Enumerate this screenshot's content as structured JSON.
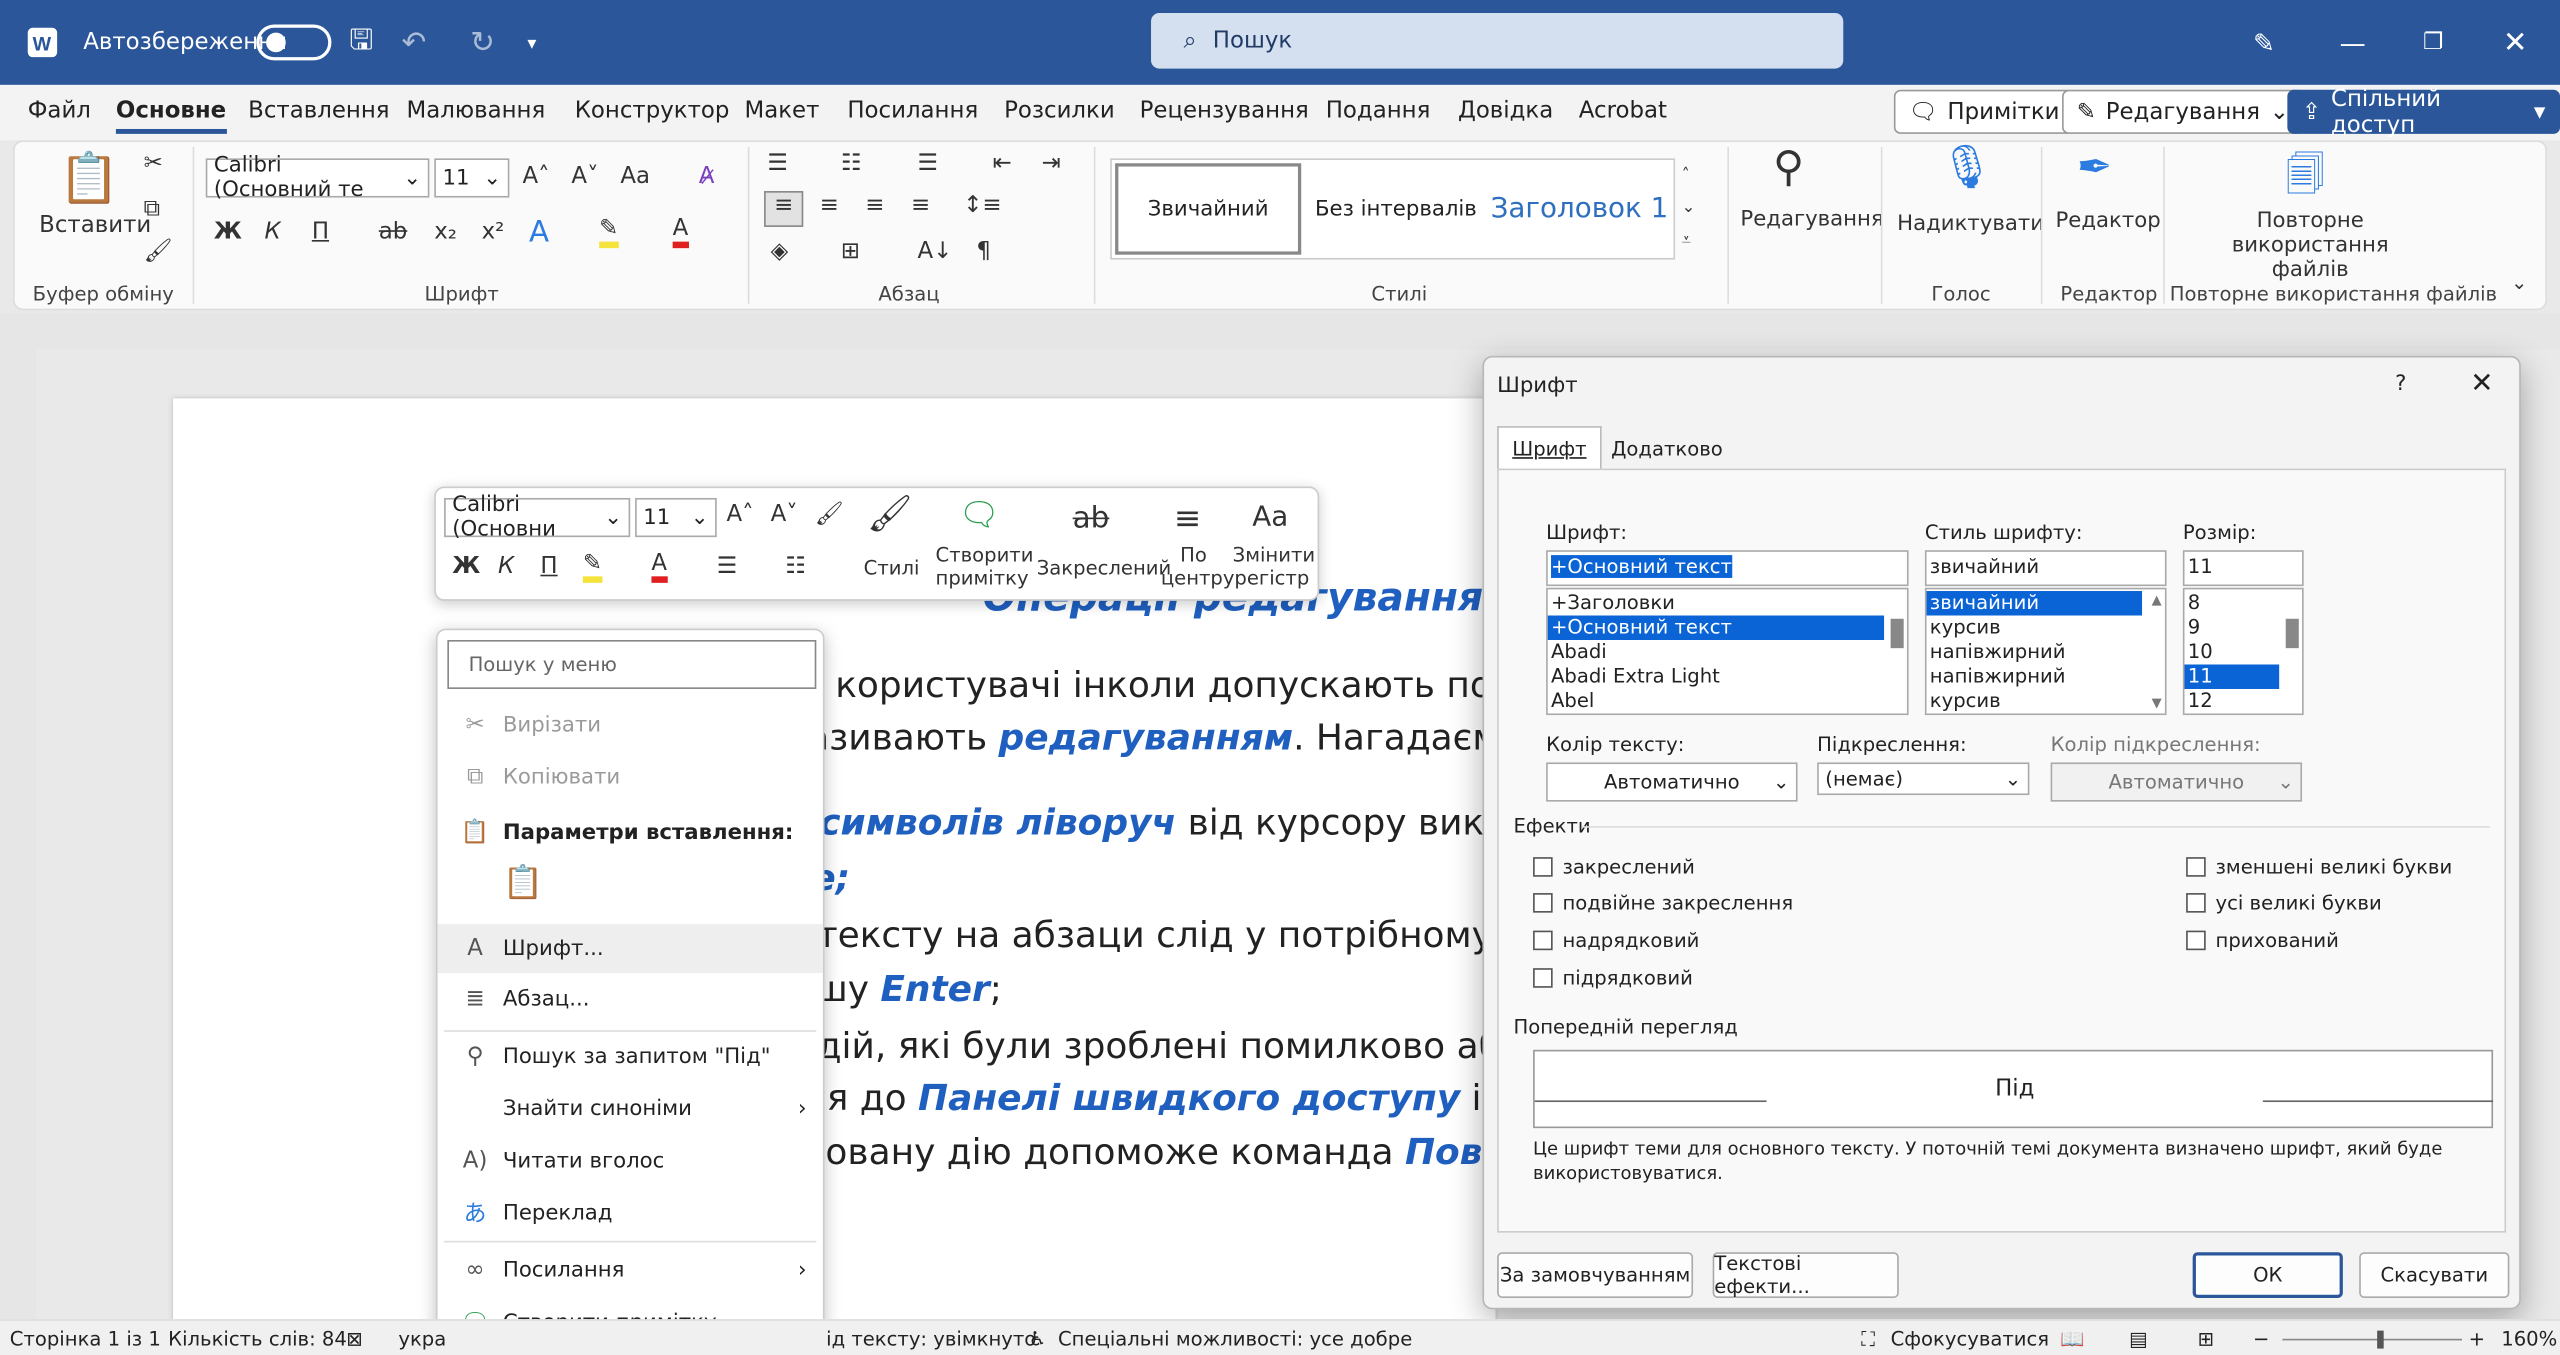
{
  "titlebar": {
    "autosave": "Автозбереження",
    "search": "Пошук"
  },
  "tabs": [
    "Файл",
    "Основне",
    "Вставлення",
    "Малювання",
    "Конструктор",
    "Макет",
    "Посилання",
    "Розсилки",
    "Рецензування",
    "Подання",
    "Довідка",
    "Acrobat"
  ],
  "header_buttons": {
    "comments": "Примітки",
    "editing": "Редагування",
    "share": "Спільний доступ"
  },
  "ribbon": {
    "paste": "Вставити",
    "font_name": "Calibri (Основний те",
    "font_size": "11",
    "styles": [
      "Звичайний",
      "Без інтервалів",
      "Заголовок 1"
    ],
    "editing": "Редагування",
    "dictate": "Надиктувати",
    "editor": "Редактор",
    "reuse": "Повторне використання файлів",
    "groups": [
      "Буфер обміну",
      "Шрифт",
      "Абзац",
      "Стилі",
      "Голос",
      "Редактор",
      "Повторне використання файлів"
    ]
  },
  "document": {
    "title": "Операції редагування",
    "l1": "гу користувачі інколи допускають пом",
    "l2a": "називають ",
    "l2b": "редагуванням",
    ". Нагадаємо": "",
    "l2c": ". Нагадаємо",
    "l3a": "я символів ліворуч",
    "l3b": " від курсору викори",
    "l4": "е;",
    "l5": "я тексту на абзаци слід у потрібному м",
    "l6a": "вішу ",
    "l6b": "Enter",
    "l6c": ";",
    "l7": "я дій, які були зроблені помилково аб",
    "l8a": "ися до ",
    "l8b": "Панелі швидкого доступу",
    "l8c": " і об",
    "l9a": "асовану дію допоможе команда ",
    "l9b": "Повер"
  },
  "minitoolbar": {
    "font": "Calibri (Основни",
    "size": "11",
    "styles": "Стилі",
    "comment": "Створити примітку",
    "strike": "Закреслений",
    "center": "По центру",
    "case": "Змінити регістр"
  },
  "context_menu": {
    "search_placeholder": "Пошук у меню",
    "items": [
      "Вирізати",
      "Копіювати",
      "Параметри вставлення:",
      "Шрифт...",
      "Абзац...",
      "Пошук за запитом \"Під\"",
      "Знайти синоніми",
      "Читати вголос",
      "Переклад",
      "Посилання",
      "Створити примітку"
    ]
  },
  "dialog": {
    "title": "Шрифт",
    "help": "?",
    "tabs": [
      "Шрифт",
      "Додатково"
    ],
    "font_label": "Шрифт:",
    "font_value": "+Основний текст",
    "font_list": [
      "+Заголовки",
      "+Основний текст",
      "Abadi",
      "Abadi Extra Light",
      "Abel"
    ],
    "style_label": "Стиль шрифту:",
    "style_value": "звичайний",
    "style_list": [
      "звичайний",
      "курсив",
      "напівжирний",
      "напівжирний курсив"
    ],
    "size_label": "Розмір:",
    "size_value": "11",
    "size_list": [
      "8",
      "9",
      "10",
      "11",
      "12"
    ],
    "color_label": "Колір тексту:",
    "color_value": "Автоматично",
    "underline_label": "Підкреслення:",
    "underline_value": "(немає)",
    "ucolor_label": "Колір підкреслення:",
    "ucolor_value": "Автоматично",
    "effects_label": "Ефекти",
    "effects_left": [
      "закреслений",
      "подвійне закреслення",
      "надрядковий",
      "підрядковий"
    ],
    "effects_right": [
      "зменшені великі букви",
      "усі великі букви",
      "прихований"
    ],
    "preview_label": "Попередній перегляд",
    "preview_text": "Під",
    "preview_note": "Це шрифт теми для основного тексту. У поточній темі документа визначено шрифт, який буде використовуватися.",
    "btn_default": "За замовчуванням",
    "btn_effects": "Текстові ефекти...",
    "btn_ok": "ОК",
    "btn_cancel": "Скасувати"
  },
  "status": {
    "page": "Сторінка 1 із 1",
    "words": "Кількість слів: 84",
    "lang": "укра",
    "predict": "ід тексту: увімкнуто",
    "access": "Спеціальні можливості: усе добре",
    "focus": "Сфокусуватися",
    "zoom": "160%"
  }
}
